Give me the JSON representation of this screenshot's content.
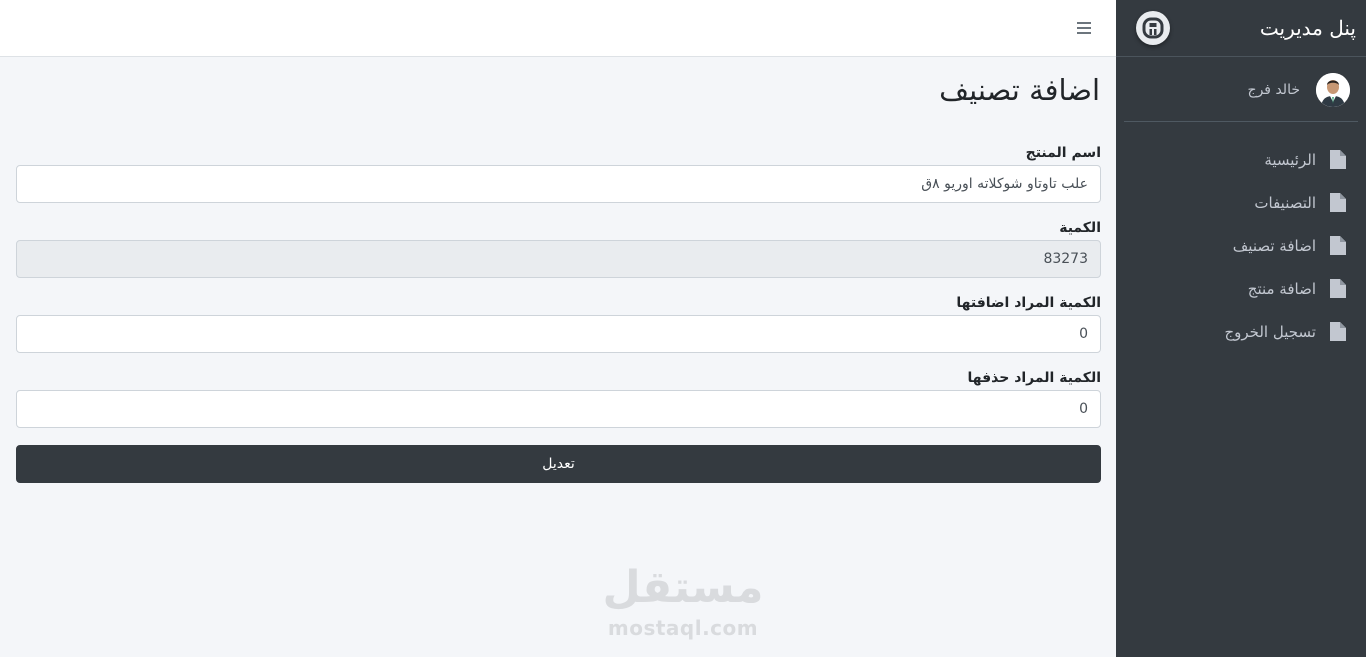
{
  "sidebar": {
    "brand_title": "پنل مدیریت",
    "user_name": "خالد فرج",
    "items": [
      {
        "label": "الرئيسية",
        "icon": "file-icon"
      },
      {
        "label": "التصنيفات",
        "icon": "file-icon"
      },
      {
        "label": "اضافة تصنيف",
        "icon": "file-icon"
      },
      {
        "label": "اضافة منتج",
        "icon": "file-icon"
      },
      {
        "label": "تسجيل الخروج",
        "icon": "file-icon"
      }
    ]
  },
  "topbar": {
    "menu_icon": "hamburger-icon"
  },
  "main": {
    "title": "اضافة تصنيف",
    "fields": {
      "product_name": {
        "label": "اسم المنتج",
        "value": "علب تاوتاو شوكلاته اوريو ٨ق"
      },
      "quantity": {
        "label": "الكمية",
        "value": "83273"
      },
      "quantity_add": {
        "label": "الكمية المراد اضافتها",
        "value": "0"
      },
      "quantity_remove": {
        "label": "الكمية المراد حذفها",
        "value": "0"
      }
    },
    "submit_label": "تعديل"
  },
  "watermark": {
    "arabic": "مستقل",
    "latin": "mostaql.com"
  },
  "colors": {
    "sidebar_bg": "#343a40",
    "content_bg": "#f4f6f9",
    "button_bg": "#343a40"
  }
}
